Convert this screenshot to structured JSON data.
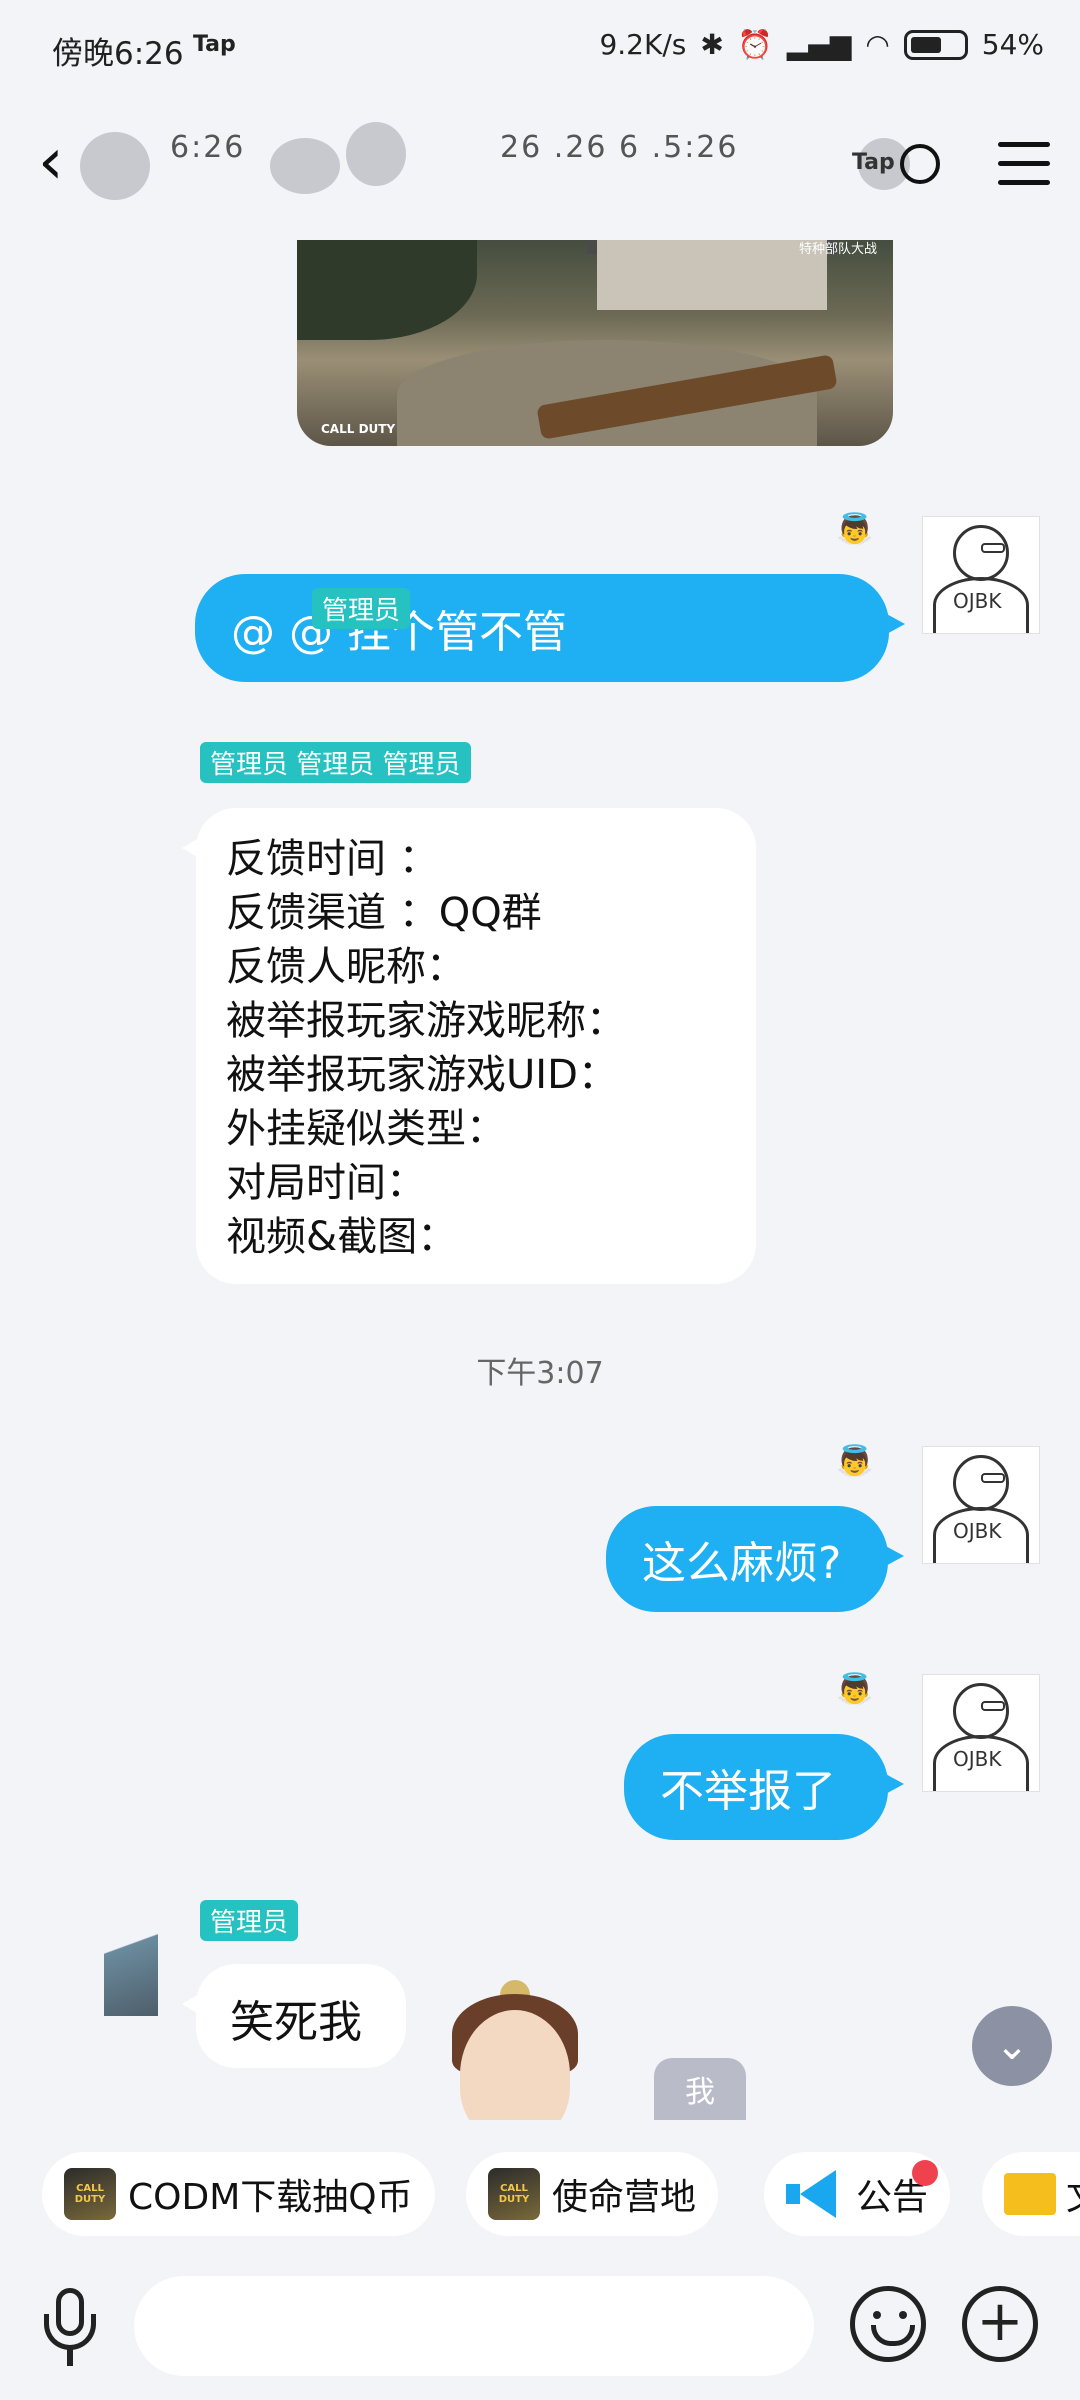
{
  "status_bar": {
    "time": "傍晚6:26",
    "app_badge": "Tap",
    "network_speed": "9.2K/s",
    "battery_percent": "54%",
    "icons": [
      "bluetooth-icon",
      "alarm-icon",
      "signal-icon",
      "wifi-icon",
      "battery-icon"
    ]
  },
  "header": {
    "title_part1": "6:26",
    "title_part2": "26  .26   6 .5:26",
    "tap_logo": "Tap"
  },
  "messages": {
    "msg1": {
      "role_tag": "管理员",
      "text": "@ @ 挂个管不管"
    },
    "msg2": {
      "role_tag": "管理员 管理员 管理员",
      "lines": [
        "反馈时间 ：",
        "反馈渠道 ：QQ群",
        "反馈人昵称：",
        "被举报玩家游戏昵称：",
        "被举报玩家游戏UID：",
        "外挂疑似类型：",
        "对局时间：",
        "视频&截图："
      ]
    },
    "timestamp": "下午3:07",
    "msg3": {
      "text": "这么麻烦?"
    },
    "msg4": {
      "text": "不举报了"
    },
    "msg5": {
      "role_tag": "管理员",
      "text": "笑死我"
    },
    "me_badge": "我",
    "avatar_text": "OJBK"
  },
  "shortcuts": [
    {
      "label": "CODM下载抽Q币",
      "icon": "call-of-duty-icon"
    },
    {
      "label": "使命营地",
      "icon": "call-of-duty-icon"
    },
    {
      "label": "公告",
      "icon": "megaphone-icon"
    },
    {
      "label": "文",
      "icon": "folder-icon"
    }
  ],
  "game_image": {
    "hud_text": "特种部队大战",
    "logo_text": "CALL DUTY"
  },
  "input": {
    "placeholder": ""
  },
  "colors": {
    "outgoing_bubble": "#1eb0f2",
    "role_tag": "#26c2c2",
    "background": "#f2f4f8"
  }
}
